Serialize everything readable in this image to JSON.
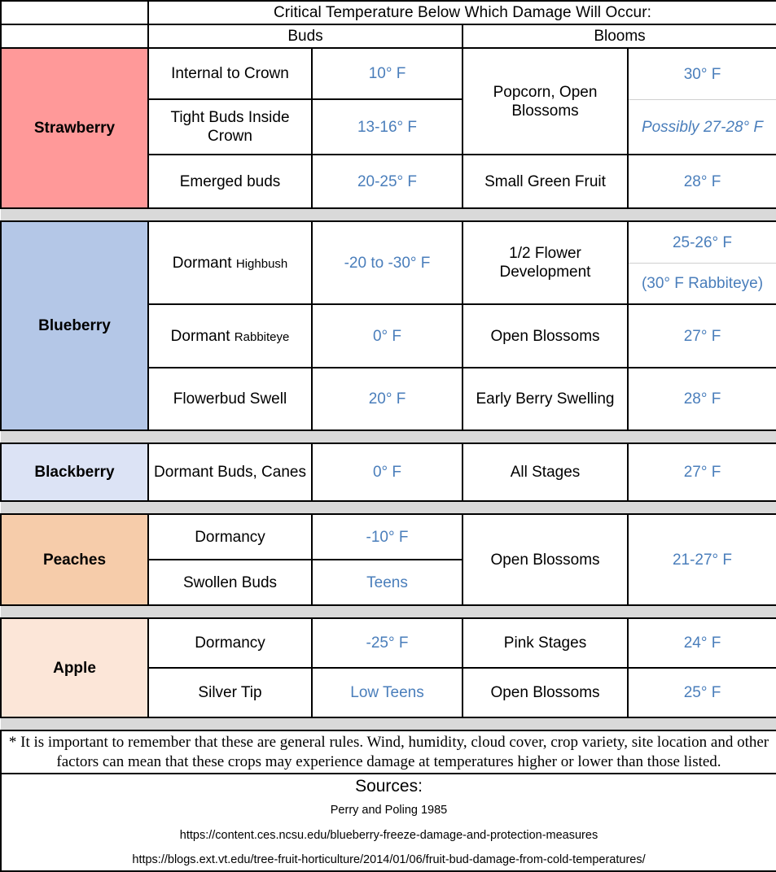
{
  "header": {
    "title": "Critical Temperature Below Which Damage Will Occur:",
    "buds_label": "Buds",
    "blooms_label": "Blooms"
  },
  "colors": {
    "title_bg": "#9dc3e6",
    "buds_bg": "#c5ddb0",
    "blooms_bg": "#fde29b",
    "temp_text": "#4a7ebb",
    "spacer": "#d9d9d9",
    "strawberry": "#ff9999",
    "blueberry": "#b4c7e7",
    "blackberry": "#dce3f5",
    "peaches": "#f6ccaa",
    "apple": "#fce6d8"
  },
  "crops": {
    "strawberry": {
      "name": "Strawberry",
      "bg": "#ff9999",
      "bud_stages": [
        "Internal to Crown",
        "Tight Buds Inside Crown",
        "Emerged buds"
      ],
      "bud_temps": [
        "10° F",
        "13-16° F",
        "20-25° F"
      ],
      "bloom_stage_1": "Popcorn, Open Blossoms",
      "bloom_temp_1a": "30° F",
      "bloom_temp_1b": "Possibly 27-28° F",
      "bloom_stage_2": "Small Green Fruit",
      "bloom_temp_2": "28° F"
    },
    "blueberry": {
      "name": "Blueberry",
      "bg": "#b4c7e7",
      "bud_stage_1_main": "Dormant",
      "bud_stage_1_sub": "Highbush",
      "bud_temp_1": "-20 to -30° F",
      "bud_stage_2_main": "Dormant",
      "bud_stage_2_sub": "Rabbiteye",
      "bud_temp_2": "0° F",
      "bud_stage_3": "Flowerbud Swell",
      "bud_temp_3": "20° F",
      "bloom_stage_1": "1/2 Flower Development",
      "bloom_temp_1a": "25-26° F",
      "bloom_temp_1b": "(30° F Rabbiteye)",
      "bloom_stage_2": "Open Blossoms",
      "bloom_temp_2": "27° F",
      "bloom_stage_3": "Early Berry Swelling",
      "bloom_temp_3": "28° F"
    },
    "blackberry": {
      "name": "Blackberry",
      "bg": "#dce3f5",
      "bud_stage": "Dormant Buds, Canes",
      "bud_temp": "0° F",
      "bloom_stage": "All Stages",
      "bloom_temp": "27° F"
    },
    "peaches": {
      "name": "Peaches",
      "bg": "#f6ccaa",
      "bud_stages": [
        "Dormancy",
        "Swollen Buds"
      ],
      "bud_temps": [
        "-10° F",
        "Teens"
      ],
      "bloom_stage": "Open Blossoms",
      "bloom_temp": "21-27° F"
    },
    "apple": {
      "name": "Apple",
      "bg": "#fce6d8",
      "bud_stages": [
        "Dormancy",
        "Silver Tip"
      ],
      "bud_temps": [
        "-25° F",
        "Low Teens"
      ],
      "bloom_stages": [
        "Pink Stages",
        "Open Blossoms"
      ],
      "bloom_temps": [
        "24° F",
        "25° F"
      ]
    }
  },
  "footnote": "* It is important to remember that these are general rules. Wind, humidity, cloud cover, crop variety, site location and other factors can mean that these crops may experience damage at temperatures higher or lower than those listed.",
  "sources": {
    "title": "Sources:",
    "items": [
      "Perry and Poling 1985",
      "https://content.ces.ncsu.edu/blueberry-freeze-damage-and-protection-measures",
      "https://blogs.ext.vt.edu/tree-fruit-horticulture/2014/01/06/fruit-bud-damage-from-cold-temperatures/"
    ]
  }
}
